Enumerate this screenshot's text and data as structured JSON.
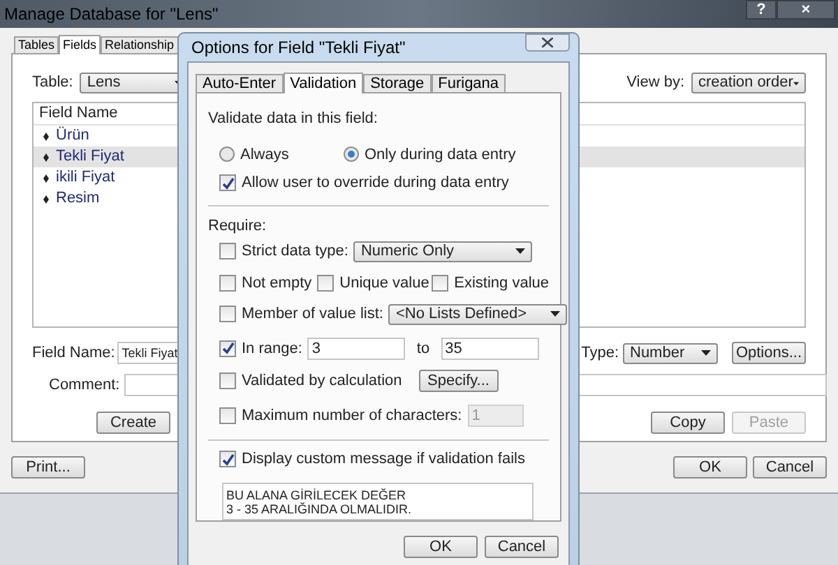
{
  "main_window": {
    "title": "Manage Database for \"Lens\"",
    "title_buttons": [
      "?",
      "×"
    ],
    "tabs": [
      {
        "label": "Tables",
        "selected": false
      },
      {
        "label": "Fields",
        "selected": true
      },
      {
        "label": "Relationship",
        "selected": false
      }
    ],
    "table_label": "Table:",
    "table_value": "Lens",
    "view_by_label": "View by:",
    "view_by_value": "creation order",
    "field_list": {
      "column": "Field Name",
      "rows": [
        {
          "name": "Ürün",
          "selected": false
        },
        {
          "name": "Tekli Fiyat",
          "selected": true
        },
        {
          "name": "ikili Fiyat",
          "selected": false
        },
        {
          "name": "Resim",
          "selected": false
        }
      ]
    },
    "field_name_label": "Field Name:",
    "field_name_value": "Tekli Fiyat",
    "type_label": "Type:",
    "type_value": "Number",
    "options_button": "Options...",
    "comment_label": "Comment:",
    "action_buttons": [
      {
        "label": "Create",
        "disabled": false
      },
      {
        "label": "Copy",
        "disabled": false
      },
      {
        "label": "Paste",
        "disabled": true
      }
    ],
    "print_button": "Print...",
    "footer_buttons": [
      "OK",
      "Cancel"
    ]
  },
  "dialog": {
    "title": "Options for Field \"Tekli Fiyat\"",
    "tabs": [
      {
        "label": "Auto-Enter",
        "selected": false
      },
      {
        "label": "Validation",
        "selected": true
      },
      {
        "label": "Storage",
        "selected": false
      },
      {
        "label": "Furigana",
        "selected": false
      }
    ],
    "validate_label": "Validate data in this field:",
    "radios": [
      {
        "label": "Always",
        "selected": false
      },
      {
        "label": "Only during data entry",
        "selected": true
      }
    ],
    "allow_override": {
      "label": "Allow user to override during data entry",
      "checked": true
    },
    "require_label": "Require:",
    "strict": {
      "label": "Strict data type:",
      "checked": false,
      "value": "Numeric Only"
    },
    "flags": [
      {
        "label": "Not empty",
        "checked": false
      },
      {
        "label": "Unique value",
        "checked": false
      },
      {
        "label": "Existing value",
        "checked": false
      }
    ],
    "member": {
      "label": "Member of value list:",
      "checked": false,
      "value": "<No Lists Defined>"
    },
    "in_range": {
      "label": "In range:",
      "checked": true,
      "from": "3",
      "to_label": "to",
      "to": "35"
    },
    "calc": {
      "label": "Validated by calculation",
      "checked": false,
      "button": "Specify..."
    },
    "max_chars": {
      "label": "Maximum number of characters:",
      "checked": false,
      "value": "1",
      "disabled": true
    },
    "custom_message": {
      "label": "Display custom message if validation fails",
      "checked": true,
      "lines": [
        "BU ALANA GİRİLECEK DEĞER",
        "3 - 35 ARALIĞINDA OLMALIDIR."
      ]
    },
    "buttons": [
      "OK",
      "Cancel"
    ]
  }
}
